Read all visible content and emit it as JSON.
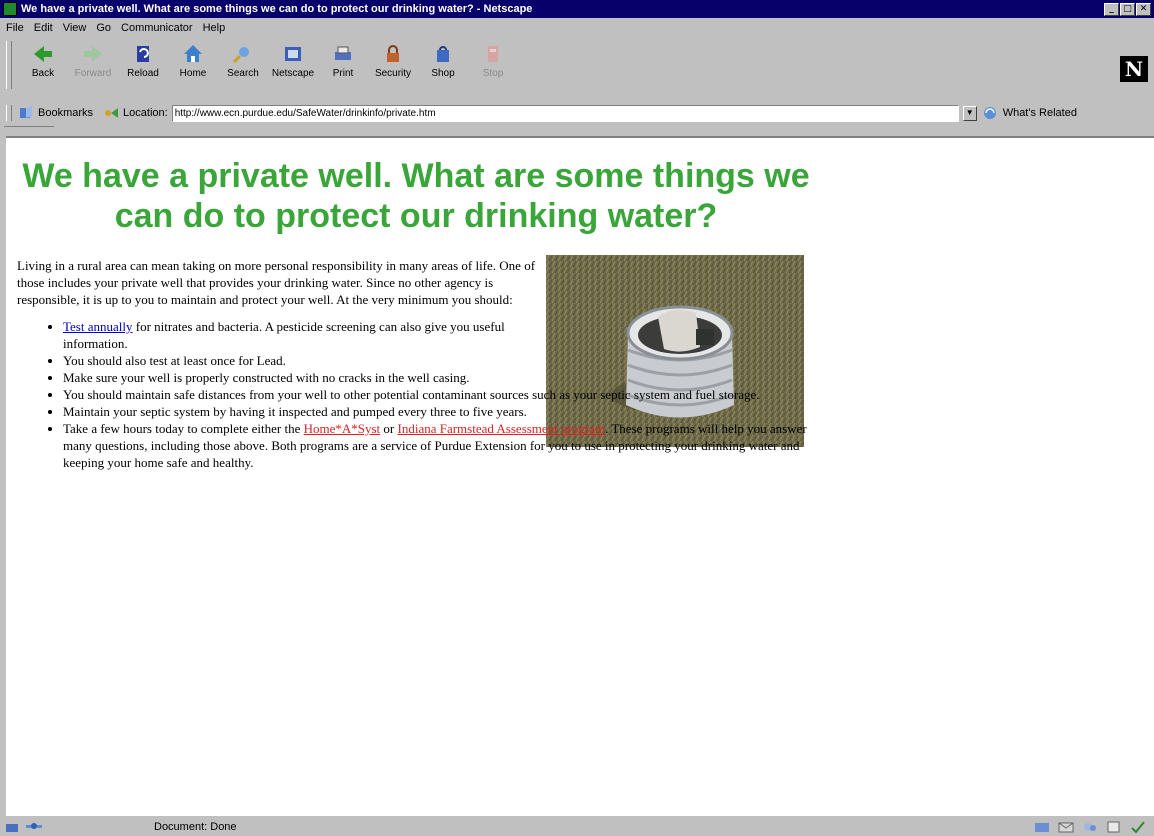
{
  "window": {
    "title": "We have a private well. What are some things we can do to protect our drinking water? - Netscape"
  },
  "menu": [
    "File",
    "Edit",
    "View",
    "Go",
    "Communicator",
    "Help"
  ],
  "toolbar": {
    "back": "Back",
    "forward": "Forward",
    "reload": "Reload",
    "home": "Home",
    "search": "Search",
    "netscape": "Netscape",
    "print": "Print",
    "security": "Security",
    "shop": "Shop",
    "stop": "Stop"
  },
  "location": {
    "bookmarks": "Bookmarks",
    "label": "Location:",
    "url": "http://www.ecn.purdue.edu/SafeWater/drinkinfo/private.htm",
    "related": "What's Related"
  },
  "page": {
    "heading": "We have a private well. What are some things we can do to protect our drinking water?",
    "intro": "Living in a rural area can mean taking on more personal responsibility in many areas of life. One of those includes your private well that provides your drinking water. Since no other agency is responsible, it is up to you to maintain and protect your well. At the very minimum you should:",
    "bullets": {
      "b1_link": "Test annually",
      "b1_text": " for nitrates and bacteria. A pesticide screening can also give you useful information.",
      "b2": "You should also test at least once for Lead.",
      "b3": "Make sure your well is properly constructed with no cracks in the well casing.",
      "b4": "You should maintain safe distances from your well to other potential contaminant sources such as your septic system and fuel storage.",
      "b5": "Maintain your septic system by having it inspected and pumped every three to five years.",
      "b6_pre": "Take a few hours today to complete either the ",
      "b6_link1": "Home*A*Syst",
      "b6_mid": " or ",
      "b6_link2": "Indiana Farmstead Assessment program",
      "b6_post": ". These programs will help you answer many questions, including those above. Both programs are a service of Purdue Extension for you to use in protecting your drinking water and keeping your home safe and healthy."
    }
  },
  "status": {
    "text": "Document: Done"
  }
}
